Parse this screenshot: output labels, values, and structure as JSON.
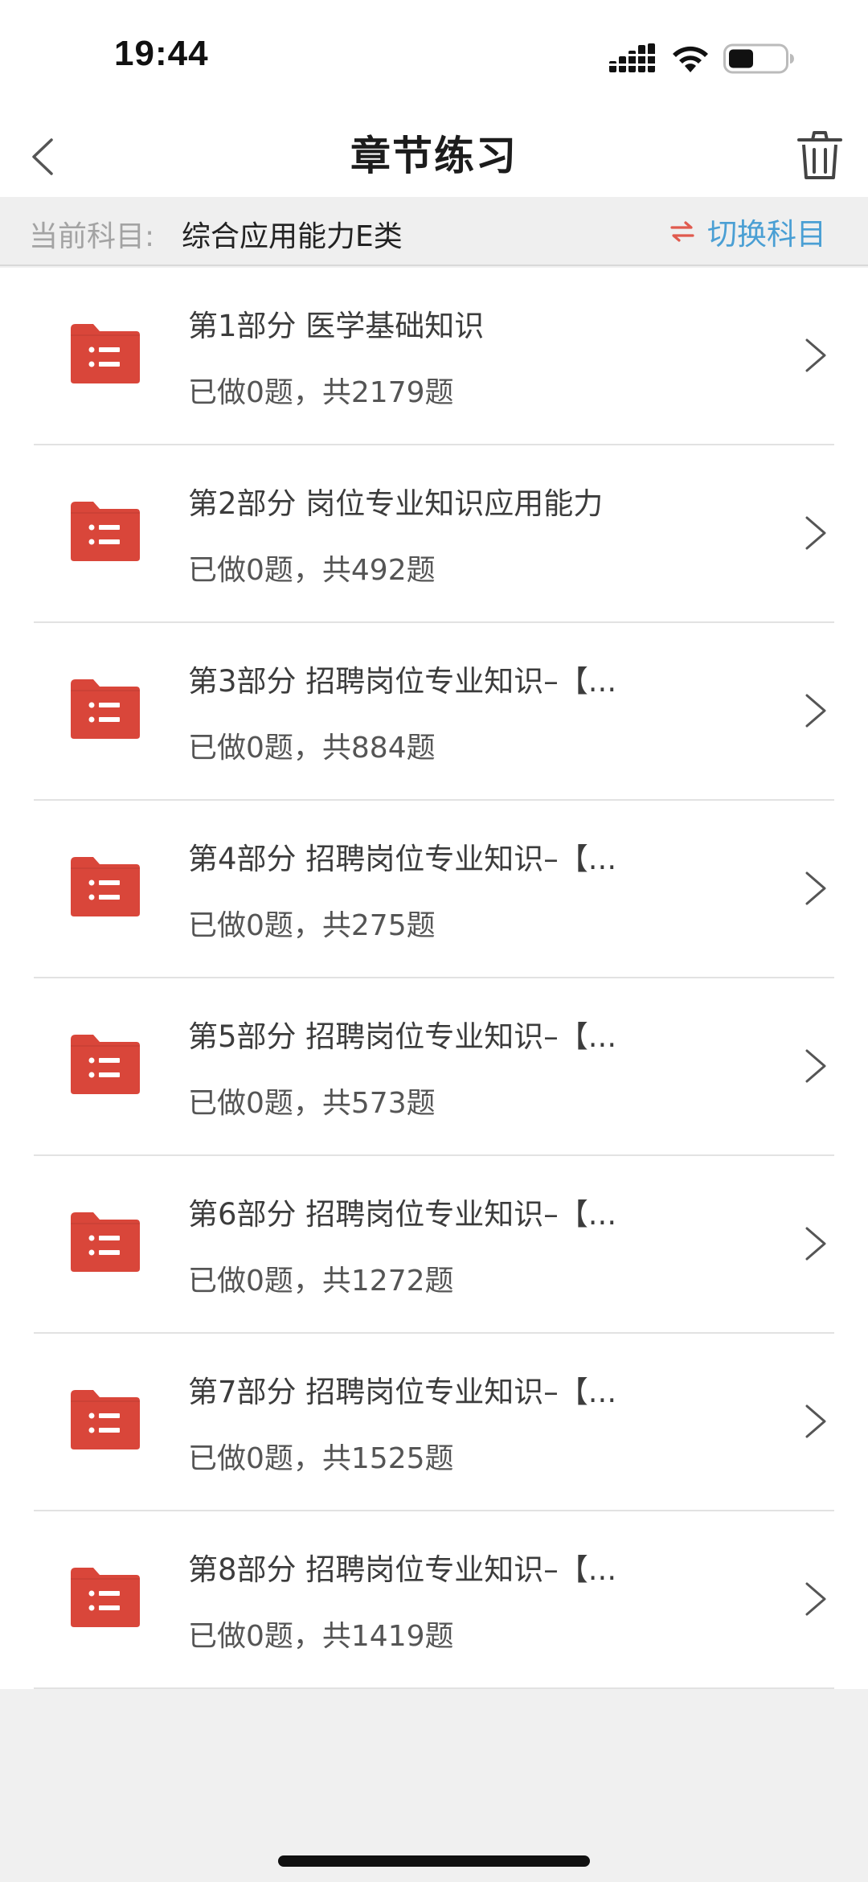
{
  "status_bar": {
    "time": "19:44",
    "battery_level": 0.45
  },
  "nav": {
    "title": "章节练习",
    "back_icon": "chevron-left-icon",
    "trash_icon": "trash-icon"
  },
  "subject": {
    "label": "当前科目:",
    "value": "综合应用能力E类",
    "switch_label": "切换科目"
  },
  "colors": {
    "accent_blue": "#4a9fd4",
    "folder_red": "#d9463a",
    "switch_red": "#e05a4e"
  },
  "items": [
    {
      "title": "第1部分  医学基础知识",
      "sub": "已做0题，共2179题"
    },
    {
      "title": "第2部分  岗位专业知识应用能力",
      "sub": "已做0题，共492题"
    },
    {
      "title": "第3部分  招聘岗位专业知识–【...",
      "sub": "已做0题，共884题"
    },
    {
      "title": "第4部分  招聘岗位专业知识–【...",
      "sub": "已做0题，共275题"
    },
    {
      "title": "第5部分  招聘岗位专业知识–【...",
      "sub": "已做0题，共573题"
    },
    {
      "title": "第6部分  招聘岗位专业知识–【...",
      "sub": "已做0题，共1272题"
    },
    {
      "title": "第7部分  招聘岗位专业知识–【...",
      "sub": "已做0题，共1525题"
    },
    {
      "title": "第8部分  招聘岗位专业知识–【...",
      "sub": "已做0题，共1419题"
    }
  ]
}
